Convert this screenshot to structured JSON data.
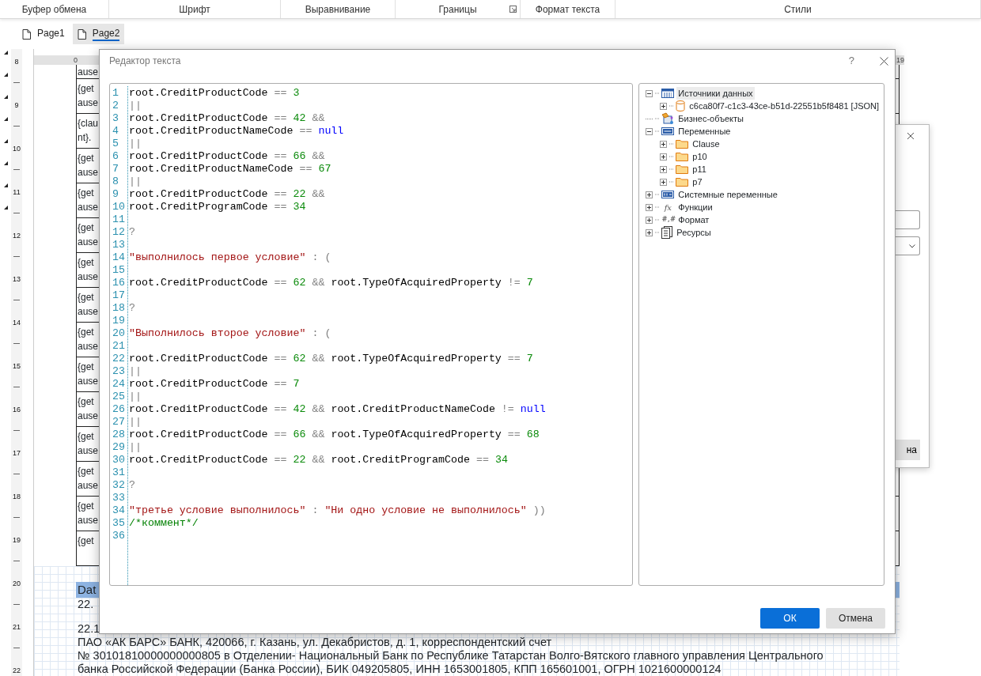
{
  "ribbon_groups": [
    {
      "label": "Буфер обмена",
      "launcher": false
    },
    {
      "label": "Шрифт",
      "launcher": false
    },
    {
      "label": "Выравнивание",
      "launcher": false
    },
    {
      "label": "Границы",
      "launcher": true
    },
    {
      "label": "Формат текста",
      "launcher": false
    },
    {
      "label": "Стили",
      "launcher": false
    }
  ],
  "page_tabs": [
    {
      "label": "Page1",
      "selected": false
    },
    {
      "label": "Page2",
      "selected": true
    }
  ],
  "document": {
    "top_ruler": [
      "0",
      "19"
    ],
    "side_ruler": [
      "8",
      "9",
      "10",
      "11",
      "12",
      "13",
      "14",
      "15",
      "16",
      "17",
      "18",
      "19",
      "20",
      "21",
      "22"
    ],
    "table_rows": [
      {
        "lines": [
          "ause"
        ]
      },
      {
        "lines": [
          "{get",
          "ause"
        ]
      },
      {
        "lines": [
          "{clau",
          "nt}."
        ]
      },
      {
        "lines": [
          "{get",
          "ause"
        ]
      },
      {
        "lines": [
          "{get",
          "ause"
        ]
      },
      {
        "lines": [
          "{get",
          "ause"
        ]
      },
      {
        "lines": [
          "{get",
          "ause"
        ]
      },
      {
        "lines": [
          "{get",
          "ause"
        ]
      },
      {
        "lines": [
          "{get",
          "ause"
        ]
      },
      {
        "lines": [
          "{get",
          "ause"
        ]
      },
      {
        "lines": [
          "{get",
          "ause"
        ]
      },
      {
        "lines": [
          "{get",
          "ause"
        ]
      },
      {
        "lines": [
          "{get",
          "ause"
        ]
      },
      {
        "lines": [
          "{get",
          "ause"
        ]
      },
      {
        "lines": [
          "{get"
        ]
      }
    ],
    "header": "Dat",
    "paragraphs": [
      "22.",
      "22.1",
      "ПАО «АК БАРС» БАНК, 420066, г. Казань, ул. Декабристов, д. 1, корреспондентский счет",
      "№ 30101810000000000805 в Отделении- Национальный Банк по Республике Татарстан Волго-Вятского главного управления Центрального",
      "банка Российской Федерации (Банка России), БИК 049205805, ИНН 1653001805, КПП 165601001, ОГРН 1021600000124"
    ]
  },
  "back_dialog": {
    "button": "на"
  },
  "dialog": {
    "title": "Редактор текста",
    "help": "?",
    "code_lines": [
      {
        "number": "1",
        "tokens": [
          {
            "kind": "id",
            "text": "root.CreditProductCode"
          },
          {
            "kind": "op",
            "text": "=="
          },
          {
            "kind": "num",
            "text": "3"
          }
        ]
      },
      {
        "number": "2",
        "tokens": [
          {
            "kind": "op",
            "text": "||"
          }
        ]
      },
      {
        "number": "3",
        "tokens": [
          {
            "kind": "id",
            "text": "root.CreditProductCode"
          },
          {
            "kind": "op",
            "text": "=="
          },
          {
            "kind": "num",
            "text": "42"
          },
          {
            "kind": "op",
            "text": "&&"
          }
        ]
      },
      {
        "number": "4",
        "tokens": [
          {
            "kind": "id",
            "text": "root.CreditProductNameCode"
          },
          {
            "kind": "op",
            "text": "=="
          },
          {
            "kind": "kw",
            "text": "null"
          }
        ]
      },
      {
        "number": "5",
        "tokens": [
          {
            "kind": "op",
            "text": "||"
          }
        ]
      },
      {
        "number": "6",
        "tokens": [
          {
            "kind": "id",
            "text": "root.CreditProductCode"
          },
          {
            "kind": "op",
            "text": "=="
          },
          {
            "kind": "num",
            "text": "66"
          },
          {
            "kind": "op",
            "text": "&&"
          }
        ]
      },
      {
        "number": "7",
        "tokens": [
          {
            "kind": "id",
            "text": "root.CreditProductNameCode"
          },
          {
            "kind": "op",
            "text": "=="
          },
          {
            "kind": "num",
            "text": "67"
          }
        ]
      },
      {
        "number": "8",
        "tokens": [
          {
            "kind": "op",
            "text": "||"
          }
        ]
      },
      {
        "number": "9",
        "tokens": [
          {
            "kind": "id",
            "text": "root.CreditProductCode"
          },
          {
            "kind": "op",
            "text": "=="
          },
          {
            "kind": "num",
            "text": "22"
          },
          {
            "kind": "op",
            "text": "&&"
          }
        ]
      },
      {
        "number": "10",
        "tokens": [
          {
            "kind": "id",
            "text": "root.CreditProgramCode"
          },
          {
            "kind": "op",
            "text": "=="
          },
          {
            "kind": "num",
            "text": "34"
          }
        ]
      },
      {
        "number": "11"
      },
      {
        "number": "12",
        "tokens": [
          {
            "kind": "op",
            "text": "?"
          }
        ]
      },
      {
        "number": "13"
      },
      {
        "number": "14",
        "tokens": [
          {
            "kind": "str",
            "text": "\"выполнилось первое условие\""
          },
          {
            "kind": "op",
            "text": ":"
          },
          {
            "kind": "op",
            "text": "("
          }
        ]
      },
      {
        "number": "15"
      },
      {
        "number": "16",
        "tokens": [
          {
            "kind": "id",
            "text": "root.CreditProductCode"
          },
          {
            "kind": "op",
            "text": "=="
          },
          {
            "kind": "num",
            "text": "62"
          },
          {
            "kind": "op",
            "text": "&&"
          },
          {
            "kind": "id",
            "text": "root.TypeOfAcquiredProperty"
          },
          {
            "kind": "op",
            "text": "!="
          },
          {
            "kind": "num",
            "text": "7"
          }
        ]
      },
      {
        "number": "17"
      },
      {
        "number": "18",
        "tokens": [
          {
            "kind": "op",
            "text": "?"
          }
        ]
      },
      {
        "number": "19"
      },
      {
        "number": "20",
        "tokens": [
          {
            "kind": "str",
            "text": "\"Выполнилось второе условие\""
          },
          {
            "kind": "op",
            "text": ":"
          },
          {
            "kind": "op",
            "text": "("
          }
        ]
      },
      {
        "number": "21"
      },
      {
        "number": "22",
        "tokens": [
          {
            "kind": "id",
            "text": "root.CreditProductCode"
          },
          {
            "kind": "op",
            "text": "=="
          },
          {
            "kind": "num",
            "text": "62"
          },
          {
            "kind": "op",
            "text": "&&"
          },
          {
            "kind": "id",
            "text": "root.TypeOfAcquiredProperty"
          },
          {
            "kind": "op",
            "text": "=="
          },
          {
            "kind": "num",
            "text": "7"
          }
        ]
      },
      {
        "number": "23",
        "tokens": [
          {
            "kind": "op",
            "text": "||"
          }
        ]
      },
      {
        "number": "24",
        "tokens": [
          {
            "kind": "id",
            "text": "root.CreditProductCode"
          },
          {
            "kind": "op",
            "text": "=="
          },
          {
            "kind": "num",
            "text": "7"
          }
        ]
      },
      {
        "number": "25",
        "tokens": [
          {
            "kind": "op",
            "text": "||"
          }
        ]
      },
      {
        "number": "26",
        "tokens": [
          {
            "kind": "id",
            "text": "root.CreditProductCode"
          },
          {
            "kind": "op",
            "text": "=="
          },
          {
            "kind": "num",
            "text": "42"
          },
          {
            "kind": "op",
            "text": "&&"
          },
          {
            "kind": "id",
            "text": "root.CreditProductNameCode"
          },
          {
            "kind": "op",
            "text": "!="
          },
          {
            "kind": "kw",
            "text": "null"
          }
        ]
      },
      {
        "number": "27",
        "tokens": [
          {
            "kind": "op",
            "text": "||"
          }
        ]
      },
      {
        "number": "28",
        "tokens": [
          {
            "kind": "id",
            "text": "root.CreditProductCode"
          },
          {
            "kind": "op",
            "text": "=="
          },
          {
            "kind": "num",
            "text": "66"
          },
          {
            "kind": "op",
            "text": "&&"
          },
          {
            "kind": "id",
            "text": "root.TypeOfAcquiredProperty"
          },
          {
            "kind": "op",
            "text": "=="
          },
          {
            "kind": "num",
            "text": "68"
          }
        ]
      },
      {
        "number": "29",
        "tokens": [
          {
            "kind": "op",
            "text": "||"
          }
        ]
      },
      {
        "number": "30",
        "tokens": [
          {
            "kind": "id",
            "text": "root.CreditProductCode"
          },
          {
            "kind": "op",
            "text": "=="
          },
          {
            "kind": "num",
            "text": "22"
          },
          {
            "kind": "op",
            "text": "&&"
          },
          {
            "kind": "id",
            "text": "root.CreditProgramCode"
          },
          {
            "kind": "op",
            "text": "=="
          },
          {
            "kind": "num",
            "text": "34"
          }
        ]
      },
      {
        "number": "31"
      },
      {
        "number": "32",
        "tokens": [
          {
            "kind": "op",
            "text": "?"
          }
        ]
      },
      {
        "number": "33"
      },
      {
        "number": "34",
        "tokens": [
          {
            "kind": "str",
            "text": "\"третье условие выполнилось\""
          },
          {
            "kind": "op",
            "text": ":"
          },
          {
            "kind": "str",
            "text": "\"Ни одно условие не выполнилось\""
          },
          {
            "kind": "op",
            "text": "))"
          }
        ]
      },
      {
        "number": "35",
        "tokens": [
          {
            "kind": "comment",
            "text": "/*коммент*/"
          }
        ]
      },
      {
        "number": "36"
      }
    ],
    "tree": [
      {
        "label": "Источники данных",
        "kind": "table",
        "expanded": true,
        "selected": true,
        "children": [
          {
            "label": "c6ca80f7-c1c3-43ce-b51d-22551b5f8481 [JSON]",
            "kind": "database",
            "expanded": false,
            "selected": false
          }
        ]
      },
      {
        "label": "Бизнес-объекты",
        "kind": "business",
        "selected": false
      },
      {
        "label": "Переменные",
        "kind": "variable",
        "expanded": true,
        "selected": false,
        "children": [
          {
            "label": "Clause",
            "kind": "folder",
            "expanded": false,
            "selected": false
          },
          {
            "label": "p10",
            "kind": "folder",
            "expanded": false,
            "selected": false
          },
          {
            "label": "p11",
            "kind": "folder",
            "expanded": false,
            "selected": false
          },
          {
            "label": "p7",
            "kind": "folder",
            "expanded": false,
            "selected": false
          }
        ]
      },
      {
        "label": "Системные переменные",
        "kind": "system",
        "expanded": false,
        "selected": false
      },
      {
        "label": "Функции",
        "kind": "glyph",
        "glyph": "fx",
        "expanded": false,
        "selected": false
      },
      {
        "label": "Формат",
        "kind": "glyph",
        "glyph": "#,#",
        "expanded": false,
        "selected": false
      },
      {
        "label": "Ресурсы",
        "kind": "resources",
        "expanded": false,
        "selected": false
      }
    ],
    "buttons": [
      {
        "label": "ОК",
        "kind": "primary"
      },
      {
        "label": "Отмена",
        "kind": "secondary"
      }
    ]
  }
}
